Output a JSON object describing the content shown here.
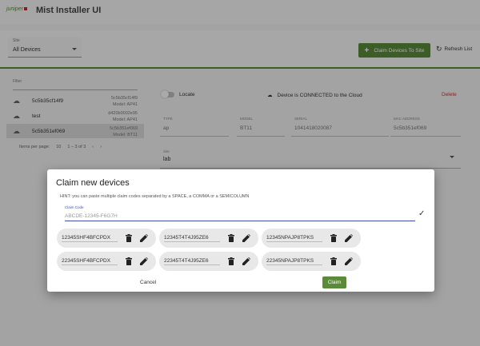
{
  "app": {
    "logo": "juniper",
    "title": "Mist Installer UI"
  },
  "toolbar": {
    "site_label": "Site",
    "site_value": "All Devices",
    "claim_button": "Claim Devices To Site",
    "refresh_button": "Refresh List"
  },
  "sidebar": {
    "filter_placeholder": "Filter",
    "devices": [
      {
        "name": "5c5b35cf14f9",
        "mac": "5c5b35cf14f9",
        "model": "Model: AP41"
      },
      {
        "name": "test",
        "mac": "d420b0002e95",
        "model": "Model: AP41"
      },
      {
        "name": "5c5b351ef069",
        "mac": "5c5b351ef069",
        "model": "Model: BT11"
      }
    ],
    "paging": {
      "items_label": "Items per page:",
      "per_page": "10",
      "range": "1 – 3 of 3"
    }
  },
  "details": {
    "locate": "Locate",
    "status": "Device is CONNECTED to the Cloud",
    "delete": "Delete",
    "fields": [
      {
        "label": "TYPE",
        "value": "ap"
      },
      {
        "label": "MODEL",
        "value": "BT11"
      },
      {
        "label": "SERIAL",
        "value": "1041418020087"
      },
      {
        "label": "MAC ADDRESS",
        "value": "5c5b351ef069"
      }
    ],
    "site_label": "Site",
    "site_value": "lab"
  },
  "dialog": {
    "title": "Claim new devices",
    "hint": "HINT: you can paste multiple claim codes separated by a SPACE, a COMMA or a SEMICOLUMN",
    "claim_code_label": "Claim Code",
    "claim_code_placeholder": "ABCDE-12345-F6G7H",
    "claim_code_value": "",
    "codes": [
      "12345SHF4BFCPDX",
      "12345T4T4J95ZE6",
      "12345NPAJP8TPKS",
      "22345SHF4BFCPDX",
      "22345T4T4J95ZE6",
      "22345NPAJP8TPKS"
    ],
    "cancel": "Cancel",
    "claim": "Claim"
  },
  "colors": {
    "accent": "#5b8a3a",
    "input_focus": "#3f51b5",
    "danger": "#cc3333"
  }
}
